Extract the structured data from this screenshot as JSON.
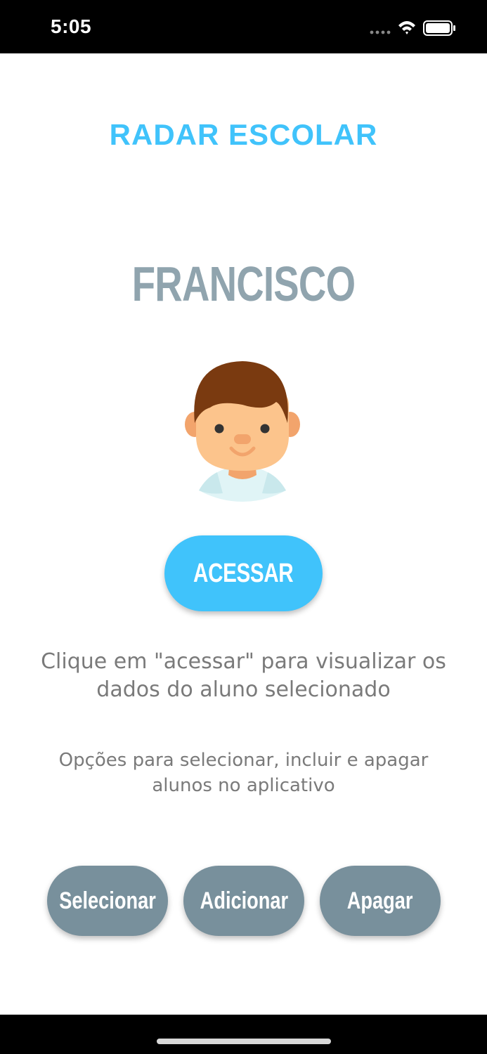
{
  "status_bar": {
    "time": "5:05",
    "icons": [
      "signal-icon",
      "wifi-icon",
      "battery-icon"
    ]
  },
  "app": {
    "title": "RADAR ESCOLAR"
  },
  "student": {
    "name": "FRANCISCO",
    "avatar": "boy-avatar-icon"
  },
  "access": {
    "label": "ACESSAR",
    "hint": "Clique em \"acessar\" para visualizar os dados do aluno selecionado"
  },
  "options": {
    "description": "Opções para selecionar, incluir e apagar alunos no aplicativo",
    "buttons": [
      {
        "label": "Selecionar"
      },
      {
        "label": "Adicionar"
      },
      {
        "label": "Apagar"
      }
    ]
  },
  "colors": {
    "accent": "#40c3fb",
    "name": "#90a4ae",
    "secondary_button": "#78909c",
    "hint_text": "#7a7a7a"
  }
}
